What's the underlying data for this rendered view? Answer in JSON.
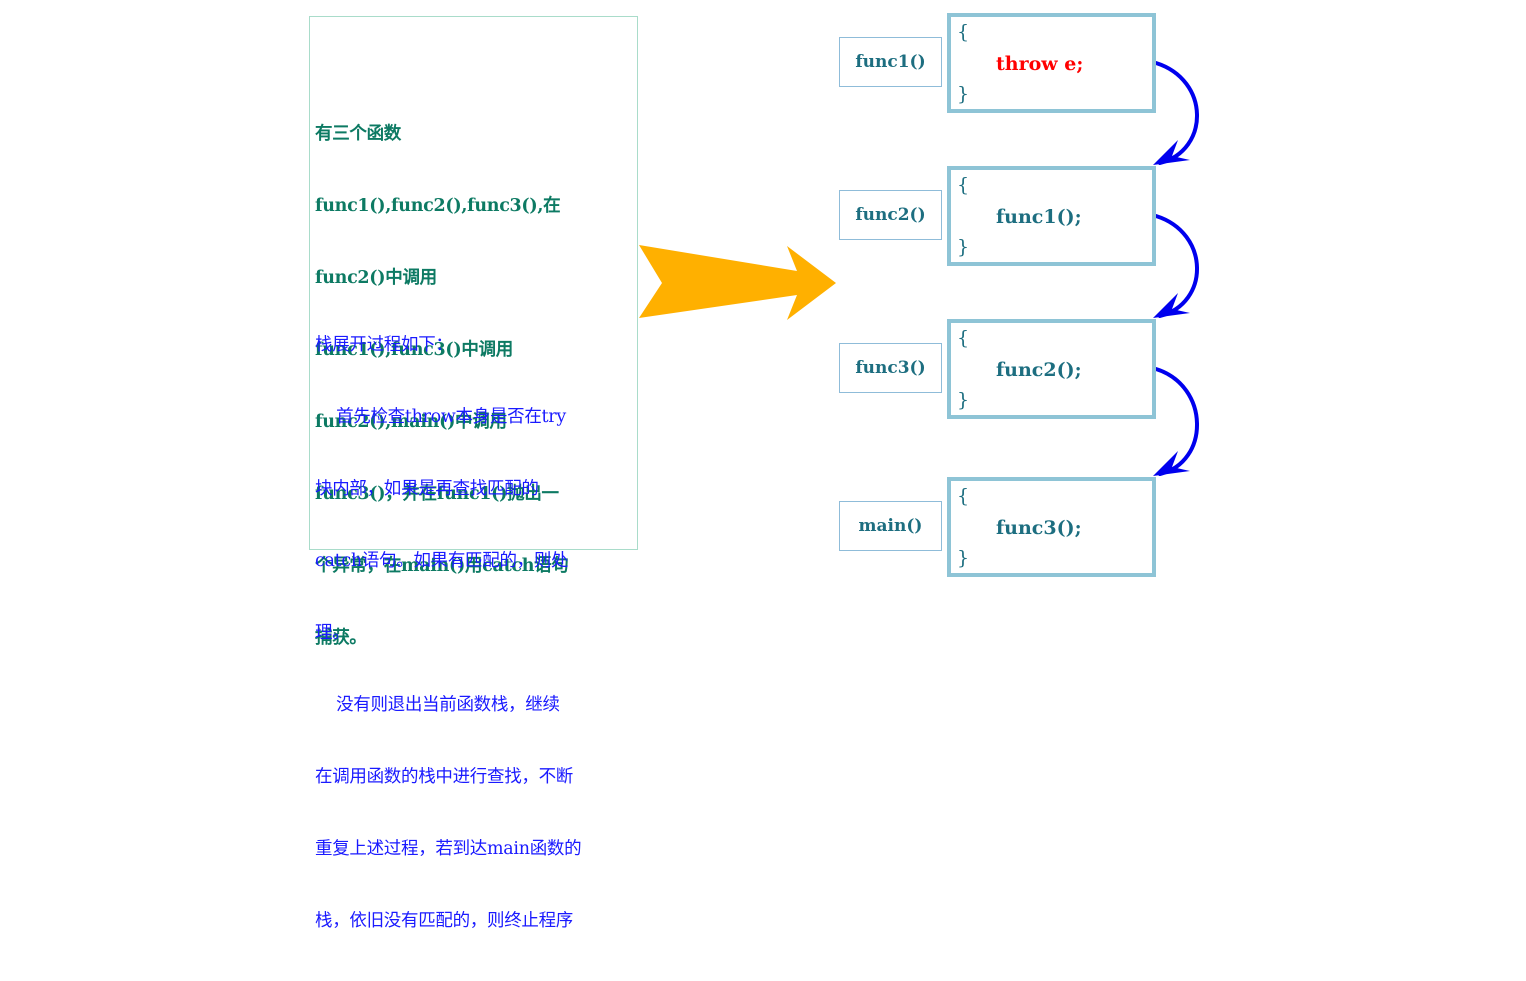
{
  "description_panel": {
    "intro_lines": [
      "有三个函数",
      "func1(),func2(),func3(),在",
      "func2()中调用",
      "func1(),func3()中调用",
      "func2(),main()中调用",
      "func3()，并在func1()抛出一",
      "个异常，在main()用catch语句",
      "捕获。"
    ],
    "explain_lines": [
      "栈展开过程如下：",
      "    首先检查throw本身是否在try",
      "块内部，如果是再查找匹配的",
      "catch语句。如果有匹配的，则处",
      "理。",
      "    没有则退出当前函数栈，继续",
      "在调用函数的栈中进行查找，不断",
      "重复上述过程，若到达main函数的",
      "栈，依旧没有匹配的，则终止程序"
    ],
    "colors": {
      "intro": "#0d7a63",
      "explain": "#1a1aff",
      "border": "#a9dcca"
    }
  },
  "big_arrow": {
    "icon": "right-arrow-icon",
    "color": "#ffb000"
  },
  "stack_frames": [
    {
      "name": "func1()",
      "open_brace": "{",
      "statement": "throw e;",
      "close_brace": "}",
      "is_throw": true
    },
    {
      "name": "func2()",
      "open_brace": "{",
      "statement": "func1();",
      "close_brace": "}",
      "is_throw": false
    },
    {
      "name": "func3()",
      "open_brace": "{",
      "statement": "func2();",
      "close_brace": "}",
      "is_throw": false
    },
    {
      "name": "main()",
      "open_brace": "{",
      "statement": "func3();",
      "close_brace": "}",
      "is_throw": false
    }
  ],
  "unwind_arrows": {
    "icon": "curved-arrow-icon",
    "color": "#0000ee",
    "count": 3
  },
  "colors": {
    "frame_border": "#8ec4d6",
    "label_border": "#8fbcd9",
    "code_text": "#1d6e80",
    "throw_text": "#ff0000"
  }
}
